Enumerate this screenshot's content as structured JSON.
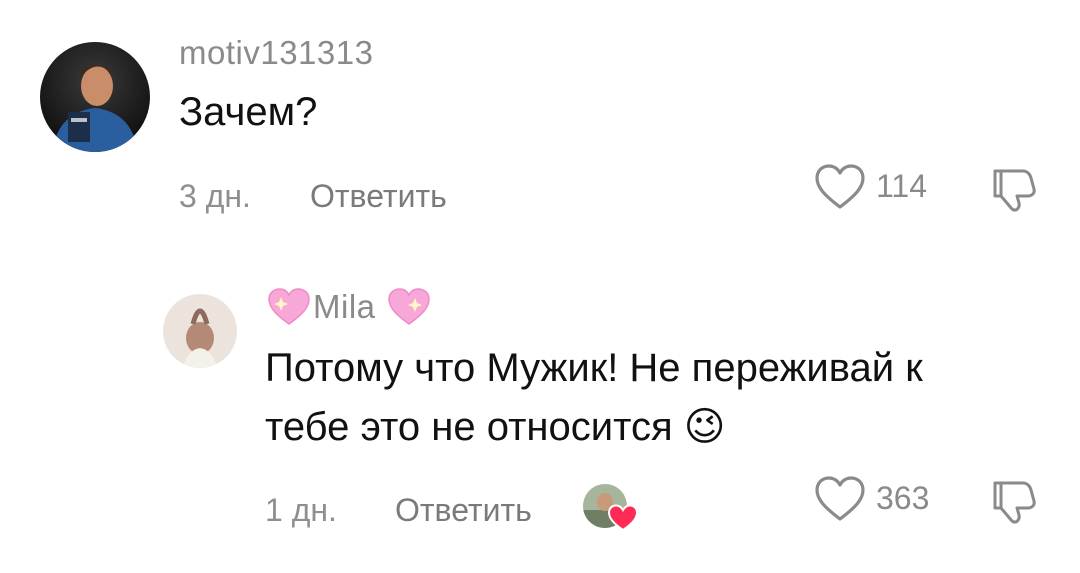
{
  "comments": [
    {
      "username": "motiv131313",
      "text": "Зачем?",
      "time": "3 дн.",
      "reply_label": "Ответить",
      "likes": "114"
    },
    {
      "username": "Mila",
      "text_line1": "Потому что Мужик! Не переживай к",
      "text_line2": "тебе это не относится",
      "emoji": "😉",
      "time": "1 дн.",
      "reply_label": "Ответить",
      "likes": "363"
    }
  ],
  "icons": {
    "like": "heart-outline-icon",
    "dislike": "thumbs-down-icon",
    "creator_heart": "heart-filled-icon",
    "sparkle_heart": "sparkling-heart-icon"
  },
  "colors": {
    "creator_heart": "#fe2c55",
    "sparkle_heart": "#f7a8d8"
  }
}
